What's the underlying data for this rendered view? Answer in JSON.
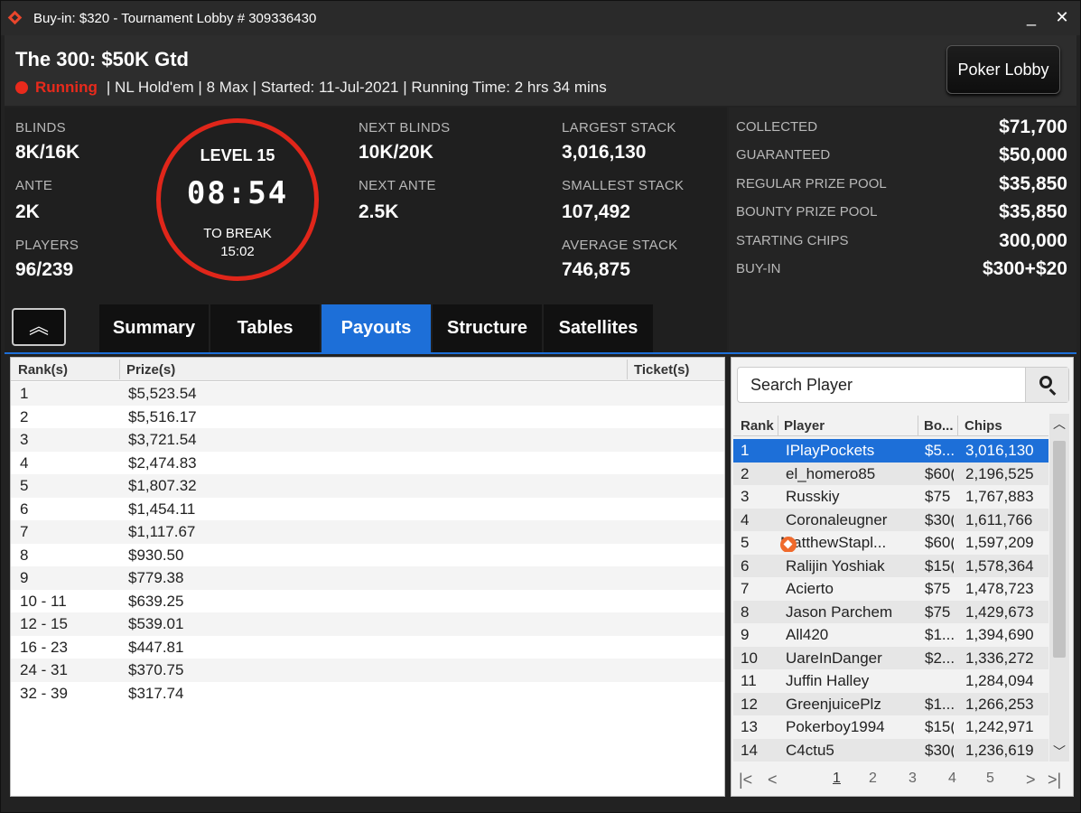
{
  "window": {
    "title": "Buy-in: $320 - Tournament Lobby # 309336430",
    "minimize": "_",
    "close": "✕"
  },
  "header": {
    "tournament_name": "The 300: $50K Gtd",
    "status": "Running",
    "info": "| NL Hold'em | 8 Max | Started: 11-Jul-2021  | Running Time: 2 hrs  34 mins",
    "lobby_button": "Poker Lobby"
  },
  "stats": {
    "blinds_label": "BLINDS",
    "blinds": "8K/16K",
    "ante_label": "ANTE",
    "ante": "2K",
    "players_label": "PLAYERS",
    "players": "96/239",
    "level": "LEVEL 15",
    "clock": "08:54",
    "to_break_label": "TO BREAK",
    "to_break": "15:02",
    "next_blinds_label": "NEXT BLINDS",
    "next_blinds": "10K/20K",
    "next_ante_label": "NEXT ANTE",
    "next_ante": "2.5K",
    "largest_label": "LARGEST STACK",
    "largest": "3,016,130",
    "smallest_label": "SMALLEST STACK",
    "smallest": "107,492",
    "average_label": "AVERAGE STACK",
    "average": "746,875"
  },
  "prizes": [
    {
      "label": "COLLECTED",
      "value": "$71,700"
    },
    {
      "label": "GUARANTEED",
      "value": "$50,000"
    },
    {
      "label": "REGULAR PRIZE POOL",
      "value": "$35,850"
    },
    {
      "label": "BOUNTY PRIZE POOL",
      "value": "$35,850"
    },
    {
      "label": "STARTING CHIPS",
      "value": "300,000"
    },
    {
      "label": "BUY-IN",
      "value": "$300+$20"
    }
  ],
  "collapse_icon": "chevron-up-double-icon",
  "tabs": [
    {
      "label": "Summary"
    },
    {
      "label": "Tables"
    },
    {
      "label": "Payouts",
      "active": true
    },
    {
      "label": "Structure"
    },
    {
      "label": "Satellites"
    }
  ],
  "payouts": {
    "headers": {
      "rank": "Rank(s)",
      "prize": "Prize(s)",
      "ticket": "Ticket(s)"
    },
    "rows": [
      {
        "rank": "1",
        "prize": "$5,523.54"
      },
      {
        "rank": "2",
        "prize": "$5,516.17"
      },
      {
        "rank": "3",
        "prize": "$3,721.54"
      },
      {
        "rank": "4",
        "prize": "$2,474.83"
      },
      {
        "rank": "5",
        "prize": "$1,807.32"
      },
      {
        "rank": "6",
        "prize": "$1,454.11"
      },
      {
        "rank": "7",
        "prize": "$1,117.67"
      },
      {
        "rank": "8",
        "prize": "$930.50"
      },
      {
        "rank": "9",
        "prize": "$779.38"
      },
      {
        "rank": "10 - 11",
        "prize": "$639.25"
      },
      {
        "rank": "12 - 15",
        "prize": "$539.01"
      },
      {
        "rank": "16 - 23",
        "prize": "$447.81"
      },
      {
        "rank": "24 - 31",
        "prize": "$370.75"
      },
      {
        "rank": "32 - 39",
        "prize": "$317.74"
      }
    ]
  },
  "players": {
    "search_placeholder": "Search Player",
    "headers": {
      "rank": "Rank",
      "player": "Player",
      "bounty": "Bo...",
      "chips": "Chips"
    },
    "rows": [
      {
        "rank": "1",
        "name": "IPlayPockets",
        "bounty": "$5...",
        "chips": "3,016,130",
        "selected": true
      },
      {
        "rank": "2",
        "name": "el_homero85",
        "bounty": "$60(",
        "chips": "2,196,525"
      },
      {
        "rank": "3",
        "name": "Russkiy",
        "bounty": "$75",
        "chips": "1,767,883"
      },
      {
        "rank": "4",
        "name": "Coronaleugner",
        "bounty": "$30(",
        "chips": "1,611,766"
      },
      {
        "rank": "5",
        "name": "MatthewStapl...",
        "bounty": "$60(",
        "chips": "1,597,209",
        "badge": true
      },
      {
        "rank": "6",
        "name": "Ralijin Yoshiak",
        "bounty": "$15(",
        "chips": "1,578,364"
      },
      {
        "rank": "7",
        "name": "Acierto",
        "bounty": "$75",
        "chips": "1,478,723"
      },
      {
        "rank": "8",
        "name": "Jason Parchem",
        "bounty": "$75",
        "chips": "1,429,673"
      },
      {
        "rank": "9",
        "name": "All420",
        "bounty": "$1...",
        "chips": "1,394,690"
      },
      {
        "rank": "10",
        "name": "UareInDanger",
        "bounty": "$2...",
        "chips": "1,336,272"
      },
      {
        "rank": "11",
        "name": "Juffin Halley",
        "bounty": "",
        "chips": "1,284,094"
      },
      {
        "rank": "12",
        "name": "GreenjuicePlz",
        "bounty": "$1...",
        "chips": "1,266,253"
      },
      {
        "rank": "13",
        "name": "Pokerboy1994",
        "bounty": "$15(",
        "chips": "1,242,971"
      },
      {
        "rank": "14",
        "name": "C4ctu5",
        "bounty": "$30(",
        "chips": "1,236,619"
      }
    ],
    "pages": [
      "1",
      "2",
      "3",
      "4",
      "5"
    ],
    "current_page": "1"
  },
  "colors": {
    "accent": "#1d6fd8",
    "running": "#e82a1c",
    "badge": "#f06a2c"
  }
}
